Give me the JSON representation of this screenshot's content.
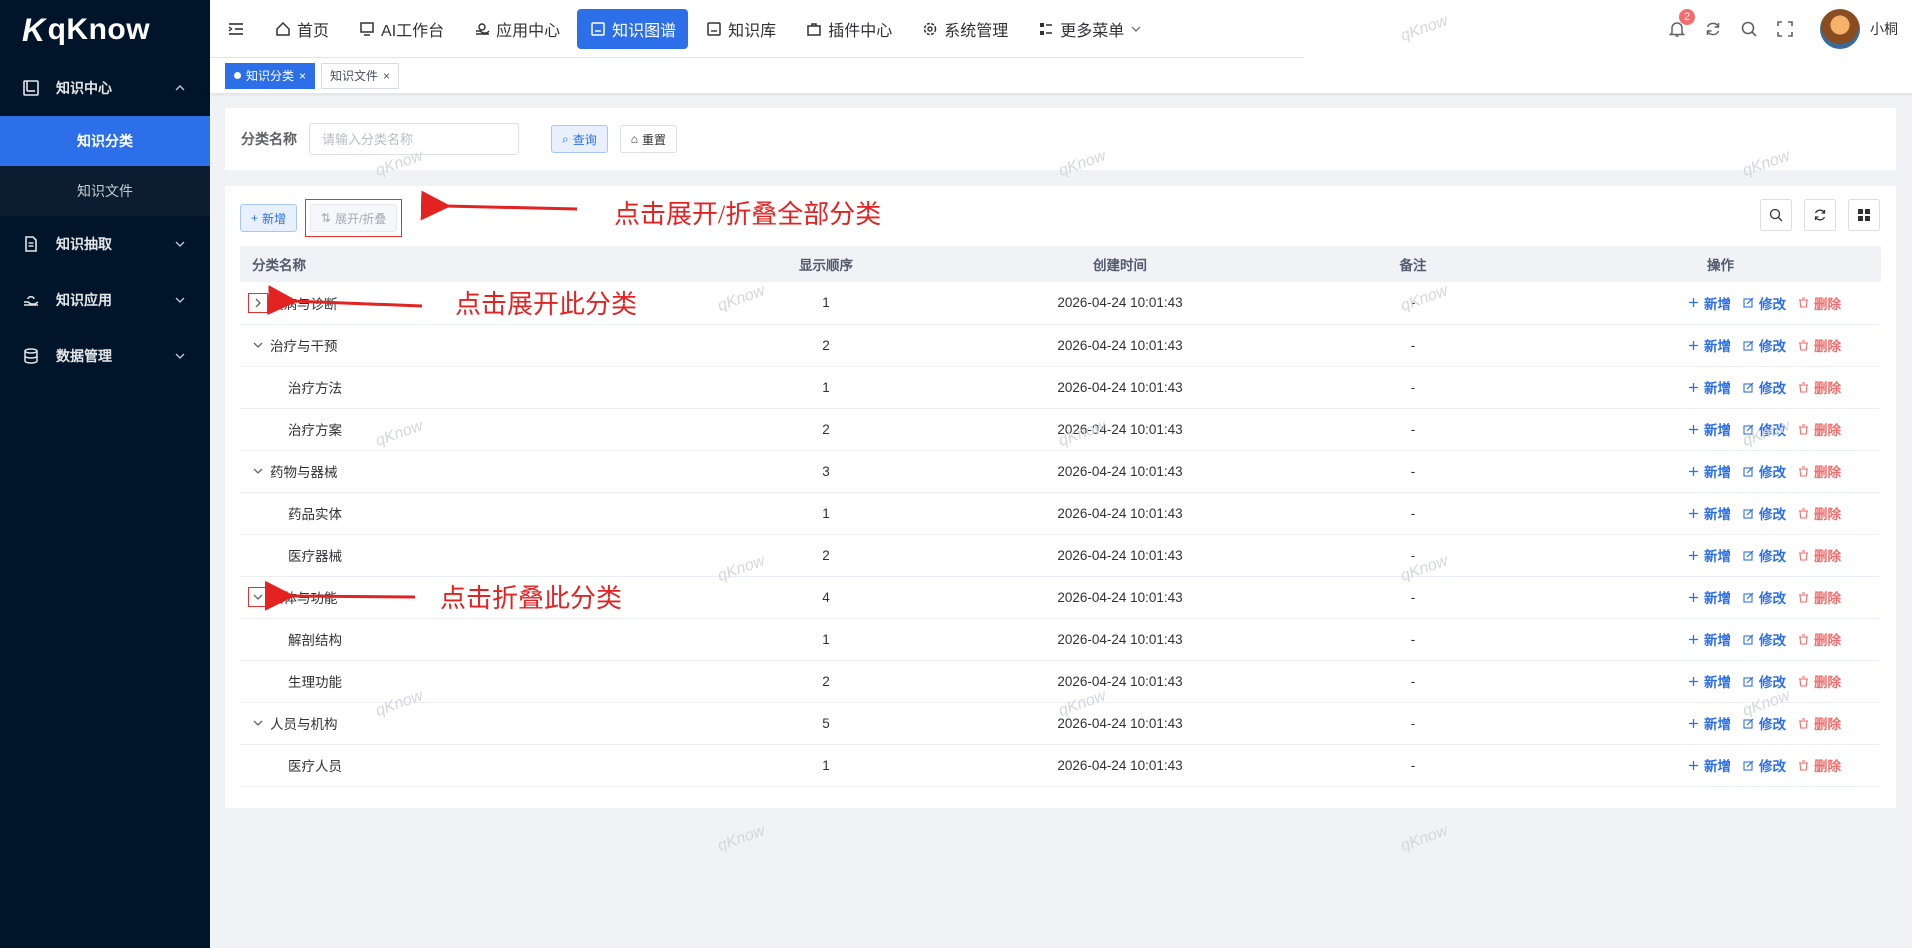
{
  "brand": {
    "name": "qKnow"
  },
  "sidebar": {
    "groups": [
      {
        "label": "知识中心",
        "icon": "book-icon",
        "expanded": true,
        "items": [
          {
            "label": "知识分类",
            "active": true
          },
          {
            "label": "知识文件",
            "active": false
          }
        ]
      },
      {
        "label": "知识抽取",
        "icon": "document-icon",
        "expanded": false
      },
      {
        "label": "知识应用",
        "icon": "hand-icon",
        "expanded": false
      },
      {
        "label": "数据管理",
        "icon": "database-icon",
        "expanded": false
      }
    ]
  },
  "topnav": {
    "tabs": [
      {
        "label": "首页",
        "icon": "home-icon",
        "active": false
      },
      {
        "label": "AI工作台",
        "icon": "monitor-icon",
        "active": false
      },
      {
        "label": "应用中心",
        "icon": "apps-icon",
        "active": false
      },
      {
        "label": "知识图谱",
        "icon": "graph-icon",
        "active": true
      },
      {
        "label": "知识库",
        "icon": "book-icon",
        "active": false
      },
      {
        "label": "插件中心",
        "icon": "briefcase-icon",
        "active": false
      },
      {
        "label": "系统管理",
        "icon": "gear-icon",
        "active": false
      },
      {
        "label": "更多菜单",
        "icon": "menu-icon",
        "active": false
      }
    ],
    "notification_count": "2",
    "user_name": "小桐"
  },
  "tags": [
    {
      "label": "知识分类",
      "active": true
    },
    {
      "label": "知识文件",
      "active": false
    }
  ],
  "search": {
    "label": "分类名称",
    "placeholder": "请输入分类名称",
    "query_label": "查询",
    "reset_label": "重置"
  },
  "toolbar": {
    "add_label": "新增",
    "expand_label": "展开/折叠"
  },
  "table": {
    "headers": {
      "name": "分类名称",
      "order": "显示顺序",
      "created": "创建时间",
      "remark": "备注",
      "actions": "操作"
    },
    "action_labels": {
      "add": "新增",
      "edit": "修改",
      "delete": "删除"
    },
    "rows": [
      {
        "name": "疾病与诊断",
        "order": "1",
        "created": "2026-04-24 10:01:43",
        "remark": "-",
        "level": 0,
        "toggle": "collapsed",
        "boxed": true
      },
      {
        "name": "治疗与干预",
        "order": "2",
        "created": "2026-04-24 10:01:43",
        "remark": "-",
        "level": 0,
        "toggle": "expanded",
        "boxed": false
      },
      {
        "name": "治疗方法",
        "order": "1",
        "created": "2026-04-24 10:01:43",
        "remark": "-",
        "level": 1,
        "toggle": "none"
      },
      {
        "name": "治疗方案",
        "order": "2",
        "created": "2026-04-24 10:01:43",
        "remark": "-",
        "level": 1,
        "toggle": "none"
      },
      {
        "name": "药物与器械",
        "order": "3",
        "created": "2026-04-24 10:01:43",
        "remark": "-",
        "level": 0,
        "toggle": "expanded",
        "boxed": false
      },
      {
        "name": "药品实体",
        "order": "1",
        "created": "2026-04-24 10:01:43",
        "remark": "-",
        "level": 1,
        "toggle": "none"
      },
      {
        "name": "医疗器械",
        "order": "2",
        "created": "2026-04-24 10:01:43",
        "remark": "-",
        "level": 1,
        "toggle": "none"
      },
      {
        "name": "人体与功能",
        "order": "4",
        "created": "2026-04-24 10:01:43",
        "remark": "-",
        "level": 0,
        "toggle": "expanded",
        "boxed": true
      },
      {
        "name": "解剖结构",
        "order": "1",
        "created": "2026-04-24 10:01:43",
        "remark": "-",
        "level": 1,
        "toggle": "none"
      },
      {
        "name": "生理功能",
        "order": "2",
        "created": "2026-04-24 10:01:43",
        "remark": "-",
        "level": 1,
        "toggle": "none"
      },
      {
        "name": "人员与机构",
        "order": "5",
        "created": "2026-04-24 10:01:43",
        "remark": "-",
        "level": 0,
        "toggle": "expanded",
        "boxed": false
      },
      {
        "name": "医疗人员",
        "order": "1",
        "created": "2026-04-24 10:01:43",
        "remark": "-",
        "level": 1,
        "toggle": "none"
      }
    ]
  },
  "annotations": {
    "expand_all": "点击展开/折叠全部分类",
    "expand_one": "点击展开此分类",
    "collapse_one": "点击折叠此分类"
  },
  "watermark": "qKnow",
  "colors": {
    "primary": "#2d6fe8",
    "sidebar_bg": "#001529",
    "danger": "#f56c6c",
    "annotation": "#e32222"
  }
}
